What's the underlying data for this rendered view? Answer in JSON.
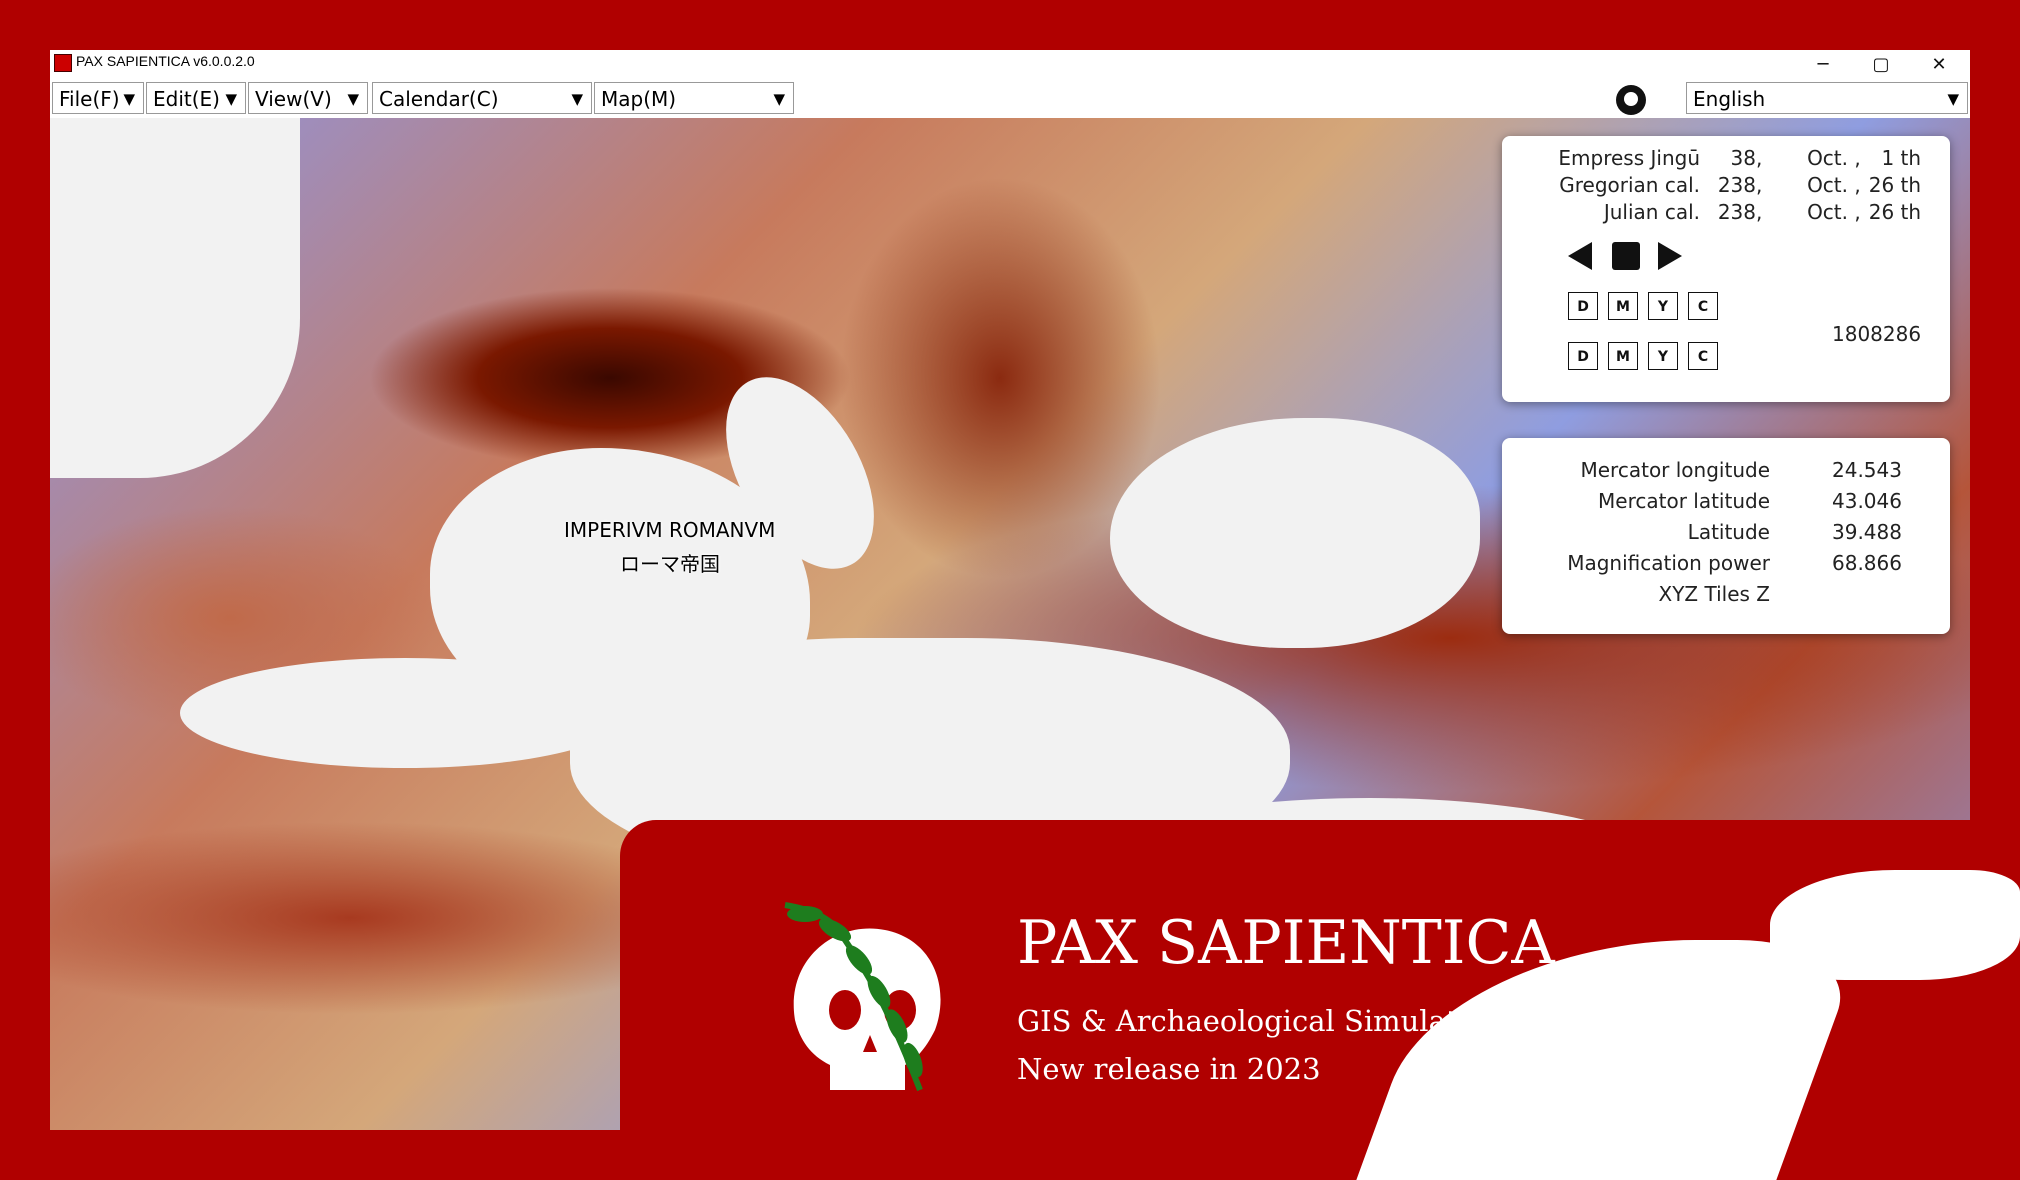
{
  "window": {
    "title": "PAX SAPIENTICA v6.0.0.2.0",
    "minimize": "─",
    "maximize": "▢",
    "close": "✕"
  },
  "menubar": {
    "file": "File(F)",
    "edit": "Edit(E)",
    "view": "View(V)",
    "calendar": "Calendar(C)",
    "map": "Map(M)",
    "language": "English",
    "arrow": "▼"
  },
  "map": {
    "label_latin": "IMPERIVM ROMANVM",
    "label_japanese": "ローマ帝国"
  },
  "calendar_panel": {
    "rows": [
      {
        "era": "Empress Jingū",
        "year": "38,",
        "month": "Oct. ,",
        "day": "1 th"
      },
      {
        "era": "Gregorian cal.",
        "year": "238,",
        "month": "Oct. ,",
        "day": "26 th"
      },
      {
        "era": "Julian cal.",
        "year": "238,",
        "month": "Oct. ,",
        "day": "26 th"
      }
    ],
    "counter": "1808286",
    "step_back": [
      "D",
      "M",
      "Y",
      "C"
    ],
    "step_forward": [
      "D",
      "M",
      "Y",
      "C"
    ]
  },
  "info_panel": {
    "rows": [
      {
        "label": "Mercator longitude",
        "value": "24.543"
      },
      {
        "label": "Mercator latitude",
        "value": "43.046"
      },
      {
        "label": "Latitude",
        "value": "39.488"
      },
      {
        "label": "Magnification power",
        "value": "68.866"
      },
      {
        "label": "XYZ Tiles Z",
        "value": ""
      }
    ]
  },
  "banner": {
    "title": "PAX SAPIENTICA",
    "subtitle": "GIS & Archaeological Simulator",
    "release": "New release in 2023"
  },
  "colors": {
    "brand_red": "#b00000",
    "laurel_green": "#1e7d1e"
  },
  "icons": [
    "app-icon",
    "github-icon",
    "play-back-icon",
    "stop-icon",
    "play-forward-icon",
    "skull-laurel-logo"
  ]
}
